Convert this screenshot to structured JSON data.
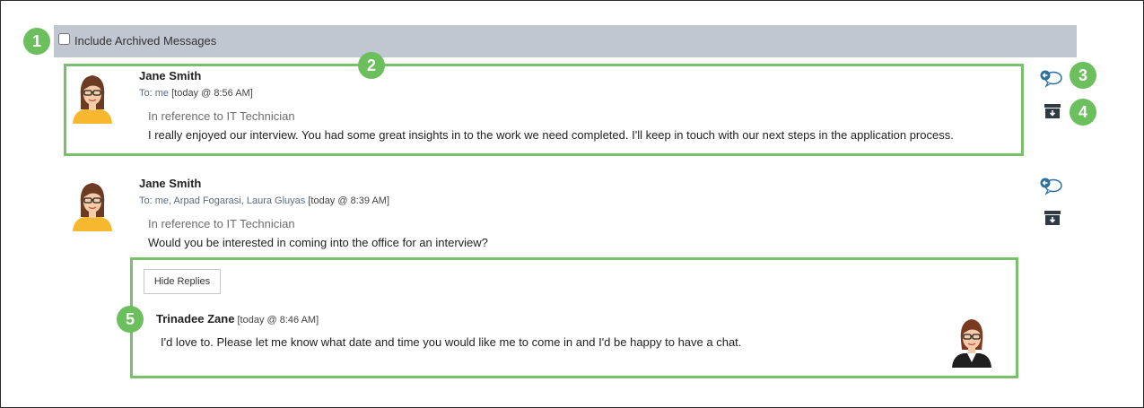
{
  "archive_filter": {
    "label": "Include Archived Messages",
    "checked": false
  },
  "callouts": [
    "1",
    "2",
    "3",
    "4",
    "5"
  ],
  "messages": [
    {
      "sender": "Jane Smith",
      "to_label": "To:",
      "recipients": "me",
      "timestamp": "[today @ 8:56 AM]",
      "reference": "In reference to IT Technician",
      "body": "I really enjoyed our interview. You had some great insights in to the work we need completed. I'll keep in touch with our next steps in the application process."
    },
    {
      "sender": "Jane Smith",
      "to_label": "To:",
      "recipients": "me, Arpad Fogarasi, Laura Gluyas",
      "timestamp": "[today @ 8:39 AM]",
      "reference": "In reference to IT Technician",
      "body": "Would you be interested in coming into the office for an interview?"
    }
  ],
  "replies": {
    "toggle_label": "Hide Replies",
    "items": [
      {
        "sender": "Trinadee Zane",
        "timestamp": "[today @ 8:46 AM]",
        "body": "I'd love to. Please let me know what date and time you would like me to come in and I'd be happy to have a chat."
      }
    ]
  },
  "icons": {
    "reply": "reply-speech-bubble-icon",
    "archive": "archive-box-icon"
  },
  "colors": {
    "callout": "#6bbf5c",
    "highlight_border": "#7abf6a",
    "filter_bar": "#c0c7d1",
    "reply_icon": "#2f6f9f",
    "archive_icon": "#2f3a45"
  }
}
